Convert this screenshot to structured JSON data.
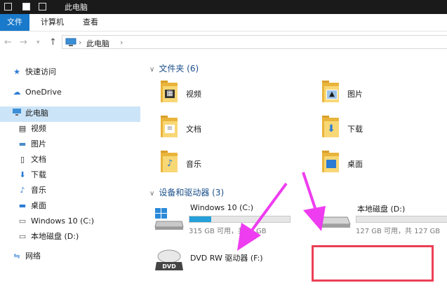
{
  "window": {
    "title": "此电脑"
  },
  "ribbon": {
    "tabs": [
      "文件",
      "计算机",
      "查看"
    ]
  },
  "address": {
    "path": "此电脑",
    "separator": "›"
  },
  "sidebar": {
    "items": [
      {
        "label": "快速访问",
        "icon": "star-icon"
      },
      {
        "label": "OneDrive",
        "icon": "cloud-icon"
      },
      {
        "label": "此电脑",
        "icon": "computer-icon",
        "selected": true
      },
      {
        "label": "视频",
        "icon": "video-icon"
      },
      {
        "label": "图片",
        "icon": "picture-icon"
      },
      {
        "label": "文档",
        "icon": "document-icon"
      },
      {
        "label": "下载",
        "icon": "download-icon"
      },
      {
        "label": "音乐",
        "icon": "music-icon"
      },
      {
        "label": "桌面",
        "icon": "desktop-icon"
      },
      {
        "label": "Windows 10 (C:)",
        "icon": "drive-icon"
      },
      {
        "label": "本地磁盘 (D:)",
        "icon": "drive-icon"
      },
      {
        "label": "网络",
        "icon": "network-icon"
      }
    ]
  },
  "folders_group": {
    "title": "文件夹 (6)"
  },
  "folders": [
    {
      "label": "视频",
      "icon": "video-folder-icon"
    },
    {
      "label": "图片",
      "icon": "picture-folder-icon"
    },
    {
      "label": "文档",
      "icon": "document-folder-icon"
    },
    {
      "label": "下载",
      "icon": "download-folder-icon"
    },
    {
      "label": "音乐",
      "icon": "music-folder-icon"
    },
    {
      "label": "桌面",
      "icon": "desktop-folder-icon"
    }
  ],
  "devices_group": {
    "title": "设备和驱动器 (3)"
  },
  "drives": [
    {
      "name": "Windows 10 (C:)",
      "free_text": "315 GB 可用，共 ... GB",
      "used_fraction": 0.22
    },
    {
      "name": "本地磁盘 (D:)",
      "free_text": "127 GB 可用，共 127 GB",
      "used_fraction": 0.0
    },
    {
      "name": "DVD RW 驱动器 (F:)"
    }
  ],
  "colors": {
    "accent": "#1979ca",
    "selection": "#cce4f7",
    "annotation": "#ec3f56",
    "arrow": "#ee3cf0"
  }
}
